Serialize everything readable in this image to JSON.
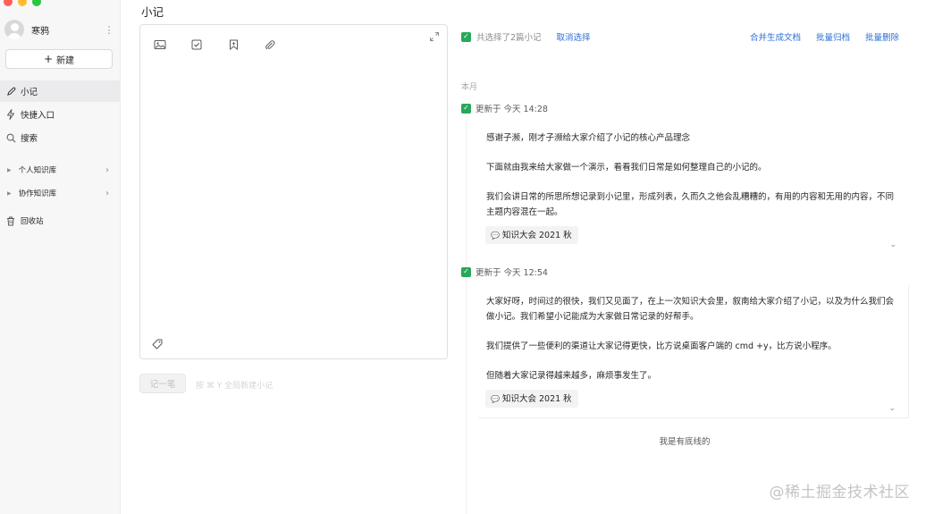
{
  "sidebar": {
    "user_name": "寒鸦",
    "more_icon": "⋮",
    "new_button_label": "新建",
    "items": [
      {
        "label": "小记",
        "icon": "pen-icon"
      },
      {
        "label": "快捷入口",
        "icon": "lightning-icon"
      },
      {
        "label": "搜索",
        "icon": "search-icon"
      },
      {
        "label": "个人知识库",
        "icon": "caret-right-icon"
      },
      {
        "label": "协作知识库",
        "icon": "caret-right-icon"
      },
      {
        "label": "回收站",
        "icon": "trash-icon"
      }
    ]
  },
  "main": {
    "title": "小记",
    "editor": {
      "toolbar_icons": [
        "image-icon",
        "checkbox-icon",
        "bookmark-icon",
        "paperclip-icon"
      ],
      "submit_label": "记一笔",
      "hint": "按 ⌘ Y 全局新建小记"
    }
  },
  "selection": {
    "summary": "共选择了2篇小记",
    "cancel_label": "取消选择",
    "actions": [
      "合并生成文档",
      "批量归档",
      "批量删除"
    ]
  },
  "timeline": {
    "month_label": "本月",
    "notes": [
      {
        "updated": "更新于 今天 14:28",
        "paragraphs": [
          "感谢子濒，刚才子濒给大家介绍了小记的核心产品理念",
          "下面就由我来给大家做一个演示，看看我们日常是如何整理自己的小记的。",
          "我们会讲日常的所思所想记录到小记里，形成列表，久而久之他会乱糟糟的，有用的内容和无用的内容，不同主题内容混在一起。"
        ],
        "tag": "知识大会 2021 秋"
      },
      {
        "updated": "更新于 今天 12:54",
        "paragraphs": [
          "大家好呀，时间过的很快，我们又见面了，在上一次知识大会里，叙南给大家介绍了小记，以及为什么我们会做小记。我们希望小记能成为大家做日常记录的好帮手。",
          "我们提供了一些便利的渠道让大家记得更快，比方说桌面客户端的 cmd +y，比方说小程序。",
          "但随着大家记录得越来越多，麻烦事发生了。"
        ],
        "tag": "知识大会 2021 秋"
      }
    ],
    "end_text": "我是有底线的"
  },
  "watermark": "@稀土掘金技术社区",
  "colors": {
    "accent": "#2b6fd6",
    "check": "#27a85a",
    "sidebar_bg": "#f7f7f8"
  }
}
